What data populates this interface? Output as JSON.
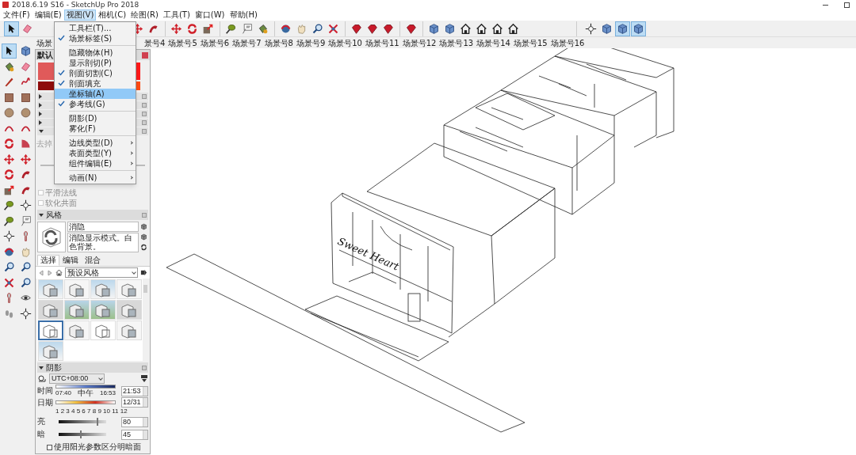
{
  "window": {
    "title": "2018.6.19 S16 - SketchUp Pro 2018"
  },
  "menu_bar": [
    {
      "label": "文件(F)",
      "selected": false
    },
    {
      "label": "编辑(E)",
      "selected": false
    },
    {
      "label": "视图(V)",
      "selected": true
    },
    {
      "label": "相机(C)",
      "selected": false
    },
    {
      "label": "绘图(R)",
      "selected": false
    },
    {
      "label": "工具(T)",
      "selected": false
    },
    {
      "label": "窗口(W)",
      "selected": false
    },
    {
      "label": "帮助(H)",
      "selected": false
    }
  ],
  "toolbar": {
    "groups": [
      [
        {
          "kind": "select",
          "selected": true
        },
        {
          "kind": "eraser",
          "selected": false
        }
      ],
      [
        {
          "kind": "move",
          "selected": false
        },
        {
          "kind": "followme",
          "selected": false
        }
      ],
      [
        {
          "kind": "move",
          "selected": false
        },
        {
          "kind": "rotate",
          "selected": false
        },
        {
          "kind": "scale",
          "selected": false
        }
      ],
      [
        {
          "kind": "tape",
          "selected": false
        },
        {
          "kind": "text",
          "selected": false
        },
        {
          "kind": "paint",
          "selected": false
        }
      ],
      [
        {
          "kind": "orbit",
          "selected": false
        },
        {
          "kind": "pan",
          "selected": false
        },
        {
          "kind": "zoom",
          "selected": false
        },
        {
          "kind": "extents",
          "selected": false
        }
      ],
      [
        {
          "kind": "gem",
          "selected": false
        },
        {
          "kind": "gem",
          "selected": false
        },
        {
          "kind": "gem",
          "selected": false
        }
      ],
      [
        {
          "kind": "gem",
          "selected": false
        }
      ],
      [
        {
          "kind": "box",
          "selected": false
        },
        {
          "kind": "box",
          "selected": false
        },
        {
          "kind": "house",
          "selected": false
        },
        {
          "kind": "house",
          "selected": false
        },
        {
          "kind": "house",
          "selected": false
        },
        {
          "kind": "house",
          "selected": false
        }
      ],
      [
        {
          "kind": "crosshair",
          "selected": false
        },
        {
          "kind": "box",
          "selected": false
        },
        {
          "kind": "box",
          "selected": true
        },
        {
          "kind": "box",
          "selected": true
        }
      ]
    ]
  },
  "scene_tabs": [
    {
      "label": "场景"
    },
    {
      "label": "景号4"
    },
    {
      "label": "场景号5"
    },
    {
      "label": "场景号6"
    },
    {
      "label": "场景号7"
    },
    {
      "label": "场景号8"
    },
    {
      "label": "场景号9"
    },
    {
      "label": "场景号10"
    },
    {
      "label": "场景号11"
    },
    {
      "label": "场景号12"
    },
    {
      "label": "场景号13"
    },
    {
      "label": "场景号14"
    },
    {
      "label": "场景号15"
    },
    {
      "label": "场景号16"
    }
  ],
  "left_toolbar": [
    {
      "kind": "select",
      "selected": true
    },
    {
      "kind": "box",
      "selected": false
    },
    {
      "kind": "paint",
      "selected": false
    },
    {
      "kind": "eraser",
      "selected": false
    },
    {
      "kind": "pencil",
      "selected": false
    },
    {
      "kind": "squiggle",
      "selected": false
    },
    {
      "kind": "square",
      "selected": false
    },
    {
      "kind": "square",
      "selected": false
    },
    {
      "kind": "circle",
      "selected": false
    },
    {
      "kind": "circle",
      "selected": false
    },
    {
      "kind": "arc",
      "selected": false
    },
    {
      "kind": "arc",
      "selected": false
    },
    {
      "kind": "rotate",
      "selected": false
    },
    {
      "kind": "pie",
      "selected": false
    },
    {
      "kind": "move",
      "selected": false
    },
    {
      "kind": "move",
      "selected": false
    },
    {
      "kind": "rotate",
      "selected": false
    },
    {
      "kind": "followme",
      "selected": false
    },
    {
      "kind": "scale",
      "selected": false
    },
    {
      "kind": "followme",
      "selected": false
    },
    {
      "kind": "tape",
      "selected": false
    },
    {
      "kind": "crosshair",
      "selected": false
    },
    {
      "kind": "tape",
      "selected": false
    },
    {
      "kind": "text",
      "selected": false
    },
    {
      "kind": "crosshair",
      "selected": false
    },
    {
      "kind": "pin",
      "selected": false
    },
    {
      "kind": "orbit",
      "selected": false
    },
    {
      "kind": "pan",
      "selected": false
    },
    {
      "kind": "zoom",
      "selected": false
    },
    {
      "kind": "zoom",
      "selected": false
    },
    {
      "kind": "extents",
      "selected": false
    },
    {
      "kind": "zoom",
      "selected": false
    },
    {
      "kind": "pin",
      "selected": false
    },
    {
      "kind": "eye",
      "selected": false
    },
    {
      "kind": "footprints",
      "selected": false
    },
    {
      "kind": "crosshair",
      "selected": false
    }
  ],
  "view_menu": [
    {
      "kind": "item",
      "label": "工具栏(T)...",
      "checked": false,
      "selected": false,
      "submenu": false
    },
    {
      "kind": "item",
      "label": "场景标签(S)",
      "checked": true,
      "selected": false,
      "submenu": false
    },
    {
      "kind": "separator"
    },
    {
      "kind": "item",
      "label": "隐藏物体(H)",
      "checked": false,
      "selected": false,
      "submenu": false
    },
    {
      "kind": "item",
      "label": "显示剖切(P)",
      "checked": false,
      "selected": false,
      "submenu": false
    },
    {
      "kind": "item",
      "label": "剖面切割(C)",
      "checked": true,
      "selected": false,
      "submenu": false
    },
    {
      "kind": "item",
      "label": "剖面填充",
      "checked": true,
      "selected": false,
      "submenu": false
    },
    {
      "kind": "item",
      "label": "坐标轴(A)",
      "checked": false,
      "selected": true,
      "submenu": false
    },
    {
      "kind": "item",
      "label": "参考线(G)",
      "checked": true,
      "selected": false,
      "submenu": false
    },
    {
      "kind": "separator"
    },
    {
      "kind": "item",
      "label": "阴影(D)",
      "checked": false,
      "selected": false,
      "submenu": false
    },
    {
      "kind": "item",
      "label": "雾化(F)",
      "checked": false,
      "selected": false,
      "submenu": false
    },
    {
      "kind": "separator"
    },
    {
      "kind": "item",
      "label": "边线类型(D)",
      "checked": false,
      "selected": false,
      "submenu": true
    },
    {
      "kind": "item",
      "label": "表面类型(Y)",
      "checked": false,
      "selected": false,
      "submenu": true
    },
    {
      "kind": "item",
      "label": "组件编辑(E)",
      "checked": false,
      "selected": false,
      "submenu": true
    },
    {
      "kind": "separator"
    },
    {
      "kind": "item",
      "label": "动画(N)",
      "checked": false,
      "selected": false,
      "submenu": true
    }
  ],
  "tray": {
    "title": "默认",
    "swatches": [
      {
        "color": "#e05a5a"
      },
      {
        "color": "#ff1a1a"
      },
      {
        "color": "#8e0b0b"
      },
      {
        "color": "#ff4a12"
      }
    ],
    "panels": [
      {
        "expanded": false
      },
      {
        "expanded": false
      },
      {
        "expanded": false
      },
      {
        "expanded": false
      },
      {
        "expanded": true
      }
    ],
    "soften": {
      "note": "去掉",
      "options": [
        {
          "label": "平滑法线",
          "checked": false,
          "disabled": true
        },
        {
          "label": "软化共面",
          "checked": false,
          "disabled": true
        }
      ]
    },
    "styles": {
      "header": "风格",
      "expanded": true,
      "name": "消隐",
      "description": "消隐显示模式。白色背景。",
      "tabs": [
        {
          "label": "选择",
          "selected": true
        },
        {
          "label": "编辑",
          "selected": false
        },
        {
          "label": "混合",
          "selected": false
        }
      ],
      "collection": "预设风格",
      "thumbnails": [
        {
          "kind": "sky",
          "selected": false
        },
        {
          "kind": "plain",
          "selected": false
        },
        {
          "kind": "sky",
          "selected": false
        },
        {
          "kind": "plain",
          "selected": false
        },
        {
          "kind": "grey",
          "selected": false
        },
        {
          "kind": "green",
          "selected": false
        },
        {
          "kind": "green",
          "selected": false
        },
        {
          "kind": "grey",
          "selected": false
        },
        {
          "kind": "sketch",
          "selected": true
        },
        {
          "kind": "plain",
          "selected": false
        },
        {
          "kind": "sketch",
          "selected": false
        },
        {
          "kind": "plain",
          "selected": false
        },
        {
          "kind": "sky",
          "selected": false
        }
      ]
    },
    "shadows": {
      "header": "阴影",
      "expanded": true,
      "timezone": "UTC+08:00",
      "time": {
        "label": "时间",
        "start": "07:40",
        "middle": "中午",
        "end": "16:53",
        "value": "21:53"
      },
      "date": {
        "label": "日期",
        "months": "1 2 3 4 5 6 7 8 9 10 11 12",
        "value": "12/31"
      },
      "light": {
        "label": "亮",
        "level": 0.8,
        "value": "80"
      },
      "dark": {
        "label": "暗",
        "level": 0.45,
        "value": "45"
      },
      "sun_shading": {
        "label": "使用阳光参数区分明暗面",
        "checked": false
      }
    }
  },
  "viewport": {
    "sign_text": "Sweet Heart"
  }
}
